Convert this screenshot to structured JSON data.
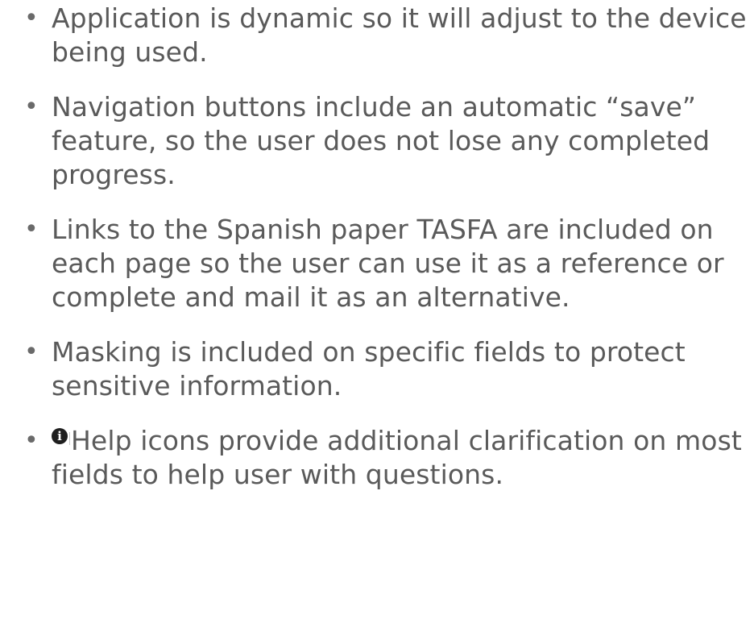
{
  "bullets": [
    {
      "text": "Application is dynamic so it will adjust to the device being used."
    },
    {
      "text": "Navigation buttons include an automatic “save” feature, so the user does not lose any completed progress."
    },
    {
      "text": "Links to the Spanish paper TASFA are included on each page so the user can use it as a reference or complete and mail it as an alternative."
    },
    {
      "text": "Masking is included on specific fields to protect sensitive information."
    },
    {
      "text": "Help icons provide additional clarification on most fields to help user with questions.",
      "icon": "info-icon"
    }
  ],
  "bullet_symbol": "•",
  "help_icon_glyph": "i",
  "colors": {
    "text": "#5a5a5a",
    "icon_bg": "#1f1f1f"
  }
}
